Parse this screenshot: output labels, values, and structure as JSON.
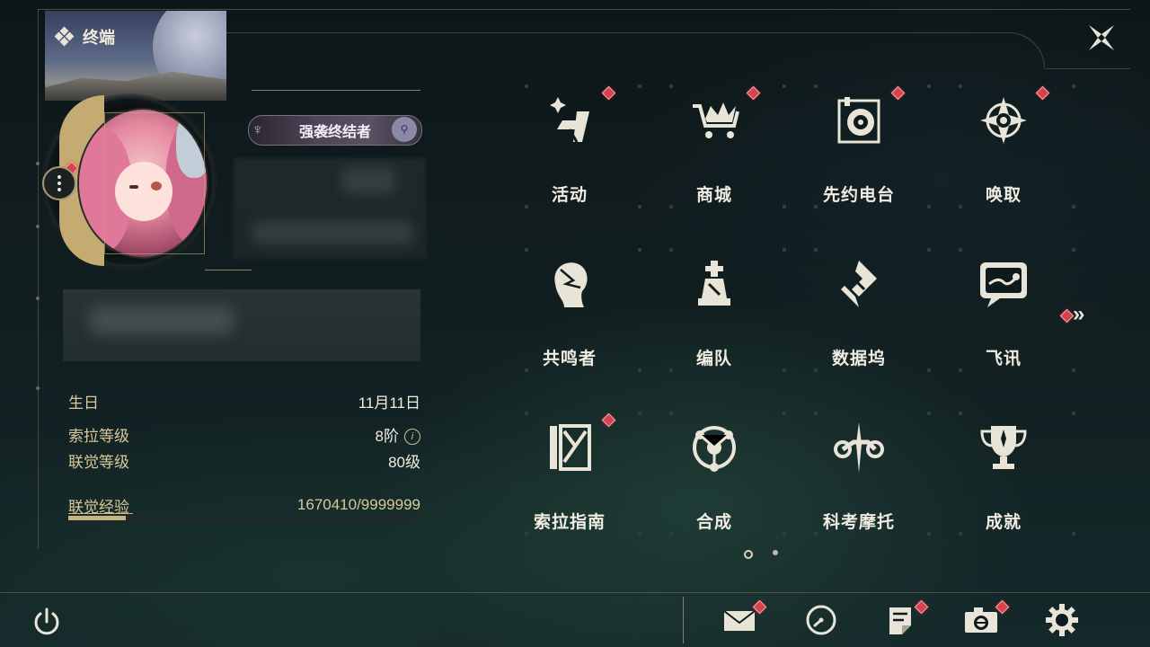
{
  "header": {
    "title": "终端",
    "icon": "terminal-diamond-icon"
  },
  "profile": {
    "title_badge": "强袭终结者",
    "birthday_label": "生日",
    "birthday_value": "11月11日",
    "sola_level_label": "索拉等级",
    "sola_level_value": "8阶",
    "union_level_label": "联觉等级",
    "union_level_value": "80级",
    "union_exp_label": "联觉经验",
    "union_exp_value": "1670410/9999999",
    "union_exp_progress": 0.167
  },
  "grid": {
    "items": [
      {
        "label": "活动",
        "icon": "events-sparkle-icon",
        "badge": true
      },
      {
        "label": "商城",
        "icon": "shop-crown-cart-icon",
        "badge": true
      },
      {
        "label": "先约电台",
        "icon": "radio-disc-icon",
        "badge": true
      },
      {
        "label": "唤取",
        "icon": "convene-compass-icon",
        "badge": true
      },
      {
        "label": "共鸣者",
        "icon": "resonator-head-icon",
        "badge": false
      },
      {
        "label": "编队",
        "icon": "team-chess-icon",
        "badge": false
      },
      {
        "label": "数据坞",
        "icon": "data-bank-icon",
        "badge": false
      },
      {
        "label": "飞讯",
        "icon": "message-bubble-icon",
        "badge": false
      },
      {
        "label": "索拉指南",
        "icon": "guide-book-icon",
        "badge": true
      },
      {
        "label": "合成",
        "icon": "synthesis-atom-icon",
        "badge": false
      },
      {
        "label": "科考摩托",
        "icon": "motorbike-icon",
        "badge": false
      },
      {
        "label": "成就",
        "icon": "trophy-icon",
        "badge": false
      }
    ],
    "page_count": 2,
    "active_page": 1
  },
  "bottom_bar": {
    "items": [
      "power-icon",
      "mail-icon",
      "clock-icon",
      "notice-icon",
      "camera-icon",
      "settings-gear-icon"
    ]
  },
  "colors": {
    "accent_gold": "#c9b382",
    "badge_red": "#d8424f",
    "text": "#f0ece2"
  }
}
